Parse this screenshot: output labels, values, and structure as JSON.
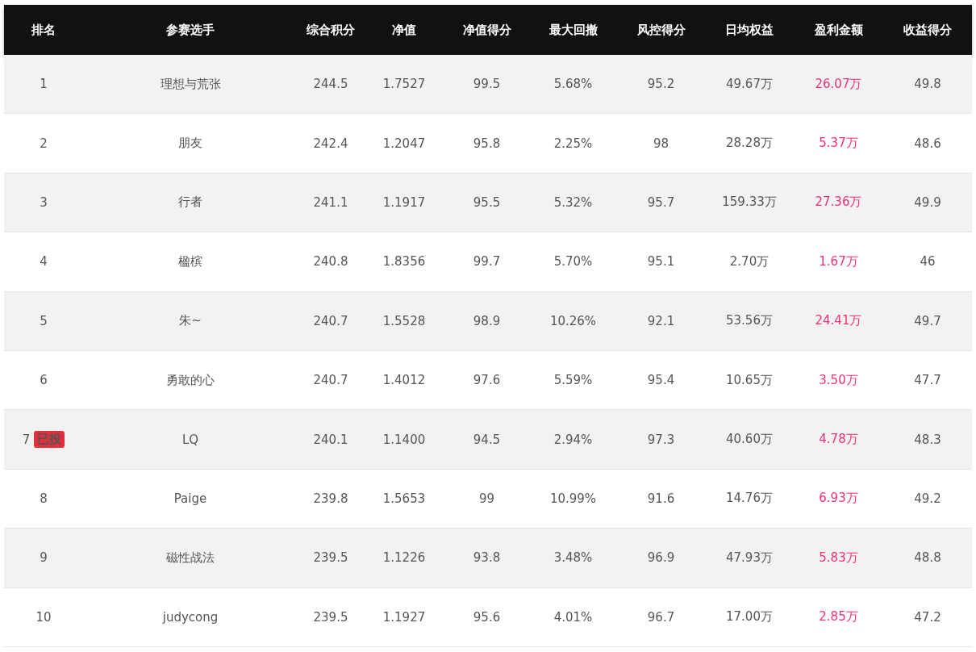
{
  "table": {
    "columns": [
      "排名",
      "参赛选手",
      "综合积分",
      "净值",
      "净值得分",
      "最大回撤",
      "风控得分",
      "日均权益",
      "盈利金额",
      "收益得分"
    ],
    "rows": [
      {
        "rank": "1",
        "badge": null,
        "player": "理想与荒张",
        "score": "244.5",
        "nav": "1.7527",
        "nav_score": "99.5",
        "max_drawdown": "5.68%",
        "risk_score": "95.2",
        "avg_equity": "49.67万",
        "profit": "26.07万",
        "return_score": "49.8"
      },
      {
        "rank": "2",
        "badge": null,
        "player": "朋友",
        "score": "242.4",
        "nav": "1.2047",
        "nav_score": "95.8",
        "max_drawdown": "2.25%",
        "risk_score": "98",
        "avg_equity": "28.28万",
        "profit": "5.37万",
        "return_score": "48.6"
      },
      {
        "rank": "3",
        "badge": null,
        "player": "行者",
        "score": "241.1",
        "nav": "1.1917",
        "nav_score": "95.5",
        "max_drawdown": "5.32%",
        "risk_score": "95.7",
        "avg_equity": "159.33万",
        "profit": "27.36万",
        "return_score": "49.9"
      },
      {
        "rank": "4",
        "badge": null,
        "player": "楹槟",
        "score": "240.8",
        "nav": "1.8356",
        "nav_score": "99.7",
        "max_drawdown": "5.70%",
        "risk_score": "95.1",
        "avg_equity": "2.70万",
        "profit": "1.67万",
        "return_score": "46"
      },
      {
        "rank": "5",
        "badge": null,
        "player": "朱~",
        "score": "240.7",
        "nav": "1.5528",
        "nav_score": "98.9",
        "max_drawdown": "10.26%",
        "risk_score": "92.1",
        "avg_equity": "53.56万",
        "profit": "24.41万",
        "return_score": "49.7"
      },
      {
        "rank": "6",
        "badge": null,
        "player": "勇敢的心",
        "score": "240.7",
        "nav": "1.4012",
        "nav_score": "97.6",
        "max_drawdown": "5.59%",
        "risk_score": "95.4",
        "avg_equity": "10.65万",
        "profit": "3.50万",
        "return_score": "47.7"
      },
      {
        "rank": "7",
        "badge": "已投",
        "player": "LQ",
        "score": "240.1",
        "nav": "1.1400",
        "nav_score": "94.5",
        "max_drawdown": "2.94%",
        "risk_score": "97.3",
        "avg_equity": "40.60万",
        "profit": "4.78万",
        "return_score": "48.3"
      },
      {
        "rank": "8",
        "badge": null,
        "player": "Paige",
        "score": "239.8",
        "nav": "1.5653",
        "nav_score": "99",
        "max_drawdown": "10.99%",
        "risk_score": "91.6",
        "avg_equity": "14.76万",
        "profit": "6.93万",
        "return_score": "49.2"
      },
      {
        "rank": "9",
        "badge": null,
        "player": "磁性战法",
        "score": "239.5",
        "nav": "1.1226",
        "nav_score": "93.8",
        "max_drawdown": "3.48%",
        "risk_score": "96.9",
        "avg_equity": "47.93万",
        "profit": "5.83万",
        "return_score": "48.8"
      },
      {
        "rank": "10",
        "badge": null,
        "player": "judycong",
        "score": "239.5",
        "nav": "1.1927",
        "nav_score": "95.6",
        "max_drawdown": "4.01%",
        "risk_score": "96.7",
        "avg_equity": "17.00万",
        "profit": "2.85万",
        "return_score": "47.2"
      }
    ]
  }
}
